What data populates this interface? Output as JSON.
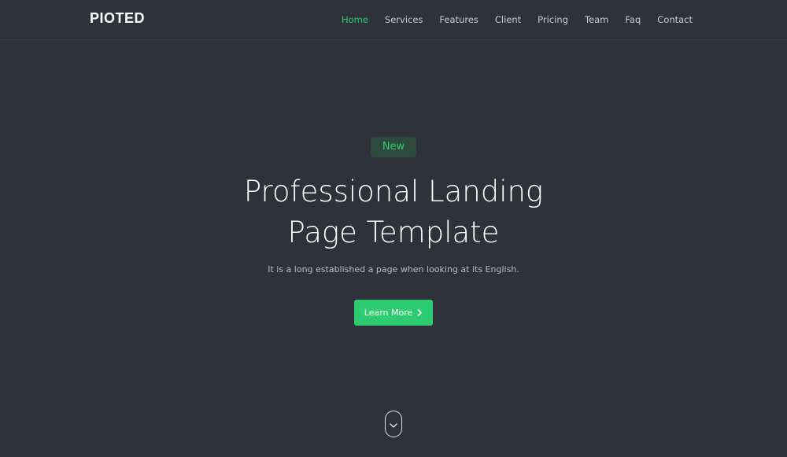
{
  "brand": {
    "logo_text": "PIOTED"
  },
  "nav": {
    "items": [
      {
        "label": "Home",
        "active": true
      },
      {
        "label": "Services",
        "active": false
      },
      {
        "label": "Features",
        "active": false
      },
      {
        "label": "Client",
        "active": false
      },
      {
        "label": "Pricing",
        "active": false
      },
      {
        "label": "Team",
        "active": false
      },
      {
        "label": "Faq",
        "active": false
      },
      {
        "label": "Contact",
        "active": false
      }
    ]
  },
  "hero": {
    "badge": "New",
    "title_line1": "Professional Landing",
    "title_line2": "Page Template",
    "subtitle": "It is a long established a page when looking at its English.",
    "cta_label": "Learn More",
    "cta_icon": "chevron-right-icon",
    "scroll_icon": "chevron-down-icon"
  },
  "colors": {
    "background": "#2f323b",
    "accent": "#2ecc71",
    "badge_bg": "#2e4a3e",
    "nav_text": "#c9cbd1"
  }
}
